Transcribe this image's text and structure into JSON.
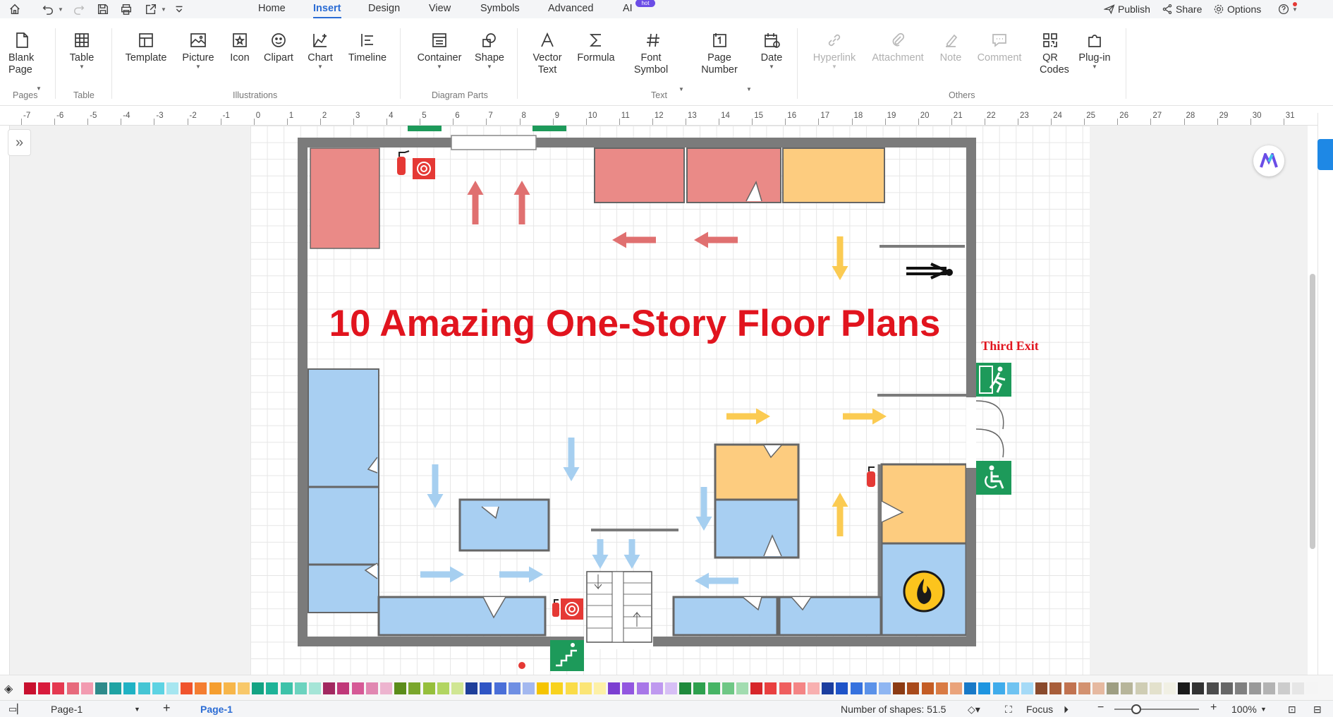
{
  "menubar": {
    "tabs": [
      "Home",
      "Insert",
      "Design",
      "View",
      "Symbols",
      "Advanced",
      "AI"
    ],
    "active_tab": "Insert",
    "ai_badge": "hot",
    "right": {
      "publish": "Publish",
      "share": "Share",
      "options": "Options"
    }
  },
  "ribbon": {
    "tools": {
      "blank_page": "Blank Page",
      "table": "Table",
      "template": "Template",
      "picture": "Picture",
      "icon": "Icon",
      "clipart": "Clipart",
      "chart": "Chart",
      "timeline": "Timeline",
      "container": "Container",
      "shape": "Shape",
      "vector_text": "Vector Text",
      "formula": "Formula",
      "font_symbol": "Font Symbol",
      "page_number": "Page Number",
      "date": "Date",
      "hyperlink": "Hyperlink",
      "attachment": "Attachment",
      "note": "Note",
      "comment": "Comment",
      "qr_codes": "QR Codes",
      "plugin": "Plug-in"
    },
    "groups": {
      "pages": "Pages",
      "table": "Table",
      "illustrations": "Illustrations",
      "diagram_parts": "Diagram Parts",
      "text": "Text",
      "others": "Others"
    }
  },
  "ruler": {
    "ticks": [
      "-7",
      "-6",
      "-5",
      "-4",
      "-3",
      "-2",
      "-1",
      "0",
      "1",
      "2",
      "3",
      "4",
      "5",
      "6",
      "7",
      "8",
      "9",
      "10",
      "11",
      "12",
      "13",
      "14",
      "15",
      "16",
      "17",
      "18",
      "19",
      "20",
      "21",
      "22",
      "23",
      "24",
      "25",
      "26",
      "27",
      "28",
      "29",
      "30",
      "31"
    ]
  },
  "canvas": {
    "title": "10 Amazing One-Story Floor Plans",
    "third_exit_label": "Third Exit",
    "colors": {
      "wall": "#7b7b7b",
      "red_room": "#ea8a87",
      "orange_room": "#fdcc7f",
      "blue_room": "#a8cff2",
      "red_arrow": "#e07070",
      "orange_arrow": "#fbcb52",
      "blue_arrow": "#a6cff0",
      "exit_green": "#1d9a5a",
      "title_red": "#e1141e"
    },
    "icons": [
      "fire-extinguisher-icon",
      "fire-hose-icon",
      "emergency-exit-icon",
      "wheelchair-icon",
      "fire-hazard-icon",
      "stairs-icon",
      "person-arrow-icon"
    ]
  },
  "palette": {
    "colors": [
      "#c8102e",
      "#d81b3c",
      "#e53950",
      "#e76a7c",
      "#f29bb0",
      "#2e8b8b",
      "#1fa3a3",
      "#20b2c4",
      "#46c5d4",
      "#5dd3e3",
      "#a6e6f0",
      "#f0542d",
      "#f47e32",
      "#f59e2f",
      "#f7b64a",
      "#f8c86a",
      "#13a383",
      "#1eb398",
      "#3dc2a9",
      "#6cd3bf",
      "#a5e5d7",
      "#a22860",
      "#c03879",
      "#d65a96",
      "#e187b1",
      "#edb4cf",
      "#5b8c1a",
      "#7aa62c",
      "#96bf3c",
      "#b2d561",
      "#d0e693",
      "#1f3f9a",
      "#2f55c4",
      "#4a6fd8",
      "#6f8fe3",
      "#a3b8ef",
      "#f5c400",
      "#f8d21e",
      "#fadc48",
      "#fbe576",
      "#fdf0a6",
      "#7b3fd1",
      "#9357e0",
      "#a877e8",
      "#bf99ef",
      "#d7bff5",
      "#1f8a3c",
      "#2ea04e",
      "#47b465",
      "#6fc785",
      "#a2dcb0",
      "#d7262a",
      "#e94040",
      "#ef5f5f",
      "#f48585",
      "#f8b0b0",
      "#1b3e9f",
      "#1f54c8",
      "#3672de",
      "#5b92e9",
      "#8fb6f2",
      "#8c3b13",
      "#a84a1b",
      "#c45d25",
      "#d97b44",
      "#eaa37a",
      "#1879c7",
      "#1e95e0",
      "#40aceb",
      "#6fc3f1",
      "#a5daf7",
      "#8a4a2c",
      "#a85e3a",
      "#c17350",
      "#d39270",
      "#e6b9a0",
      "#9e9e82",
      "#b7b59a",
      "#cfcdb4",
      "#e3e1cc",
      "#f1f0e4",
      "#1a1a1a",
      "#333333",
      "#4d4d4d",
      "#666666",
      "#808080",
      "#999999",
      "#b3b3b3",
      "#cccccc",
      "#e6e6e6",
      "#f5f5f5"
    ]
  },
  "status": {
    "page_select": "Page-1",
    "page_tab": "Page-1",
    "shapes_count": "Number of shapes: 51.5",
    "focus": "Focus",
    "zoom": "100%"
  }
}
